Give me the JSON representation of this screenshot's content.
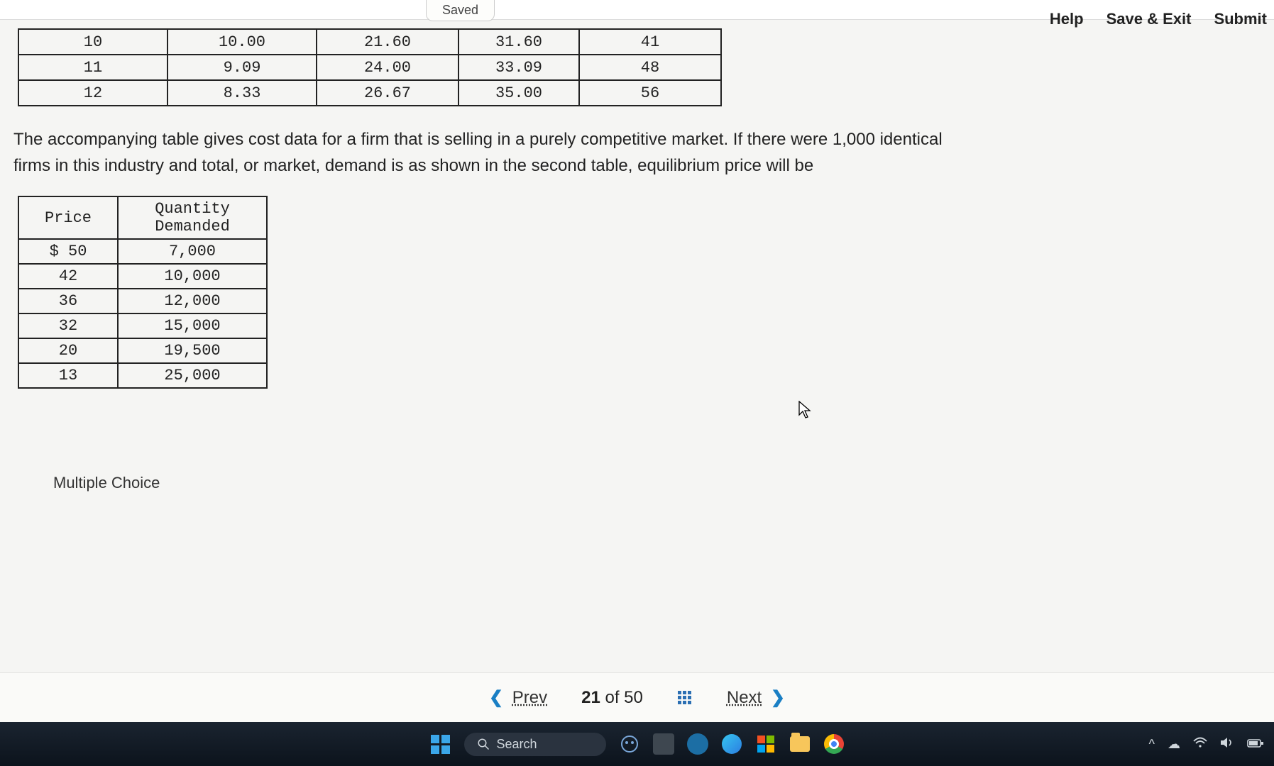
{
  "header": {
    "saved_label": "Saved",
    "links": {
      "help": "Help",
      "save_exit": "Save & Exit",
      "submit": "Submit"
    }
  },
  "cost_table": {
    "rows": [
      {
        "c1": "10",
        "c2": "10.00",
        "c3": "21.60",
        "c4": "31.60",
        "c5": "41"
      },
      {
        "c1": "11",
        "c2": "9.09",
        "c3": "24.00",
        "c4": "33.09",
        "c5": "48"
      },
      {
        "c1": "12",
        "c2": "8.33",
        "c3": "26.67",
        "c4": "35.00",
        "c5": "56"
      }
    ]
  },
  "question_text": "The accompanying table gives cost data for a firm that is selling in a purely competitive market. If there were 1,000 identical firms in this industry and total, or market, demand is as shown in the second table, equilibrium price will be",
  "demand_table": {
    "headers": {
      "price": "Price",
      "qty": "Quantity\nDemanded"
    },
    "rows": [
      {
        "price": "$ 50",
        "qty": "7,000"
      },
      {
        "price": "42",
        "qty": "10,000"
      },
      {
        "price": "36",
        "qty": "12,000"
      },
      {
        "price": "32",
        "qty": "15,000"
      },
      {
        "price": "20",
        "qty": "19,500"
      },
      {
        "price": "13",
        "qty": "25,000"
      }
    ]
  },
  "mc_label": "Multiple Choice",
  "nav": {
    "prev": "Prev",
    "next": "Next",
    "current": "21",
    "of": "of",
    "total": "50"
  },
  "taskbar": {
    "search_placeholder": "Search"
  }
}
